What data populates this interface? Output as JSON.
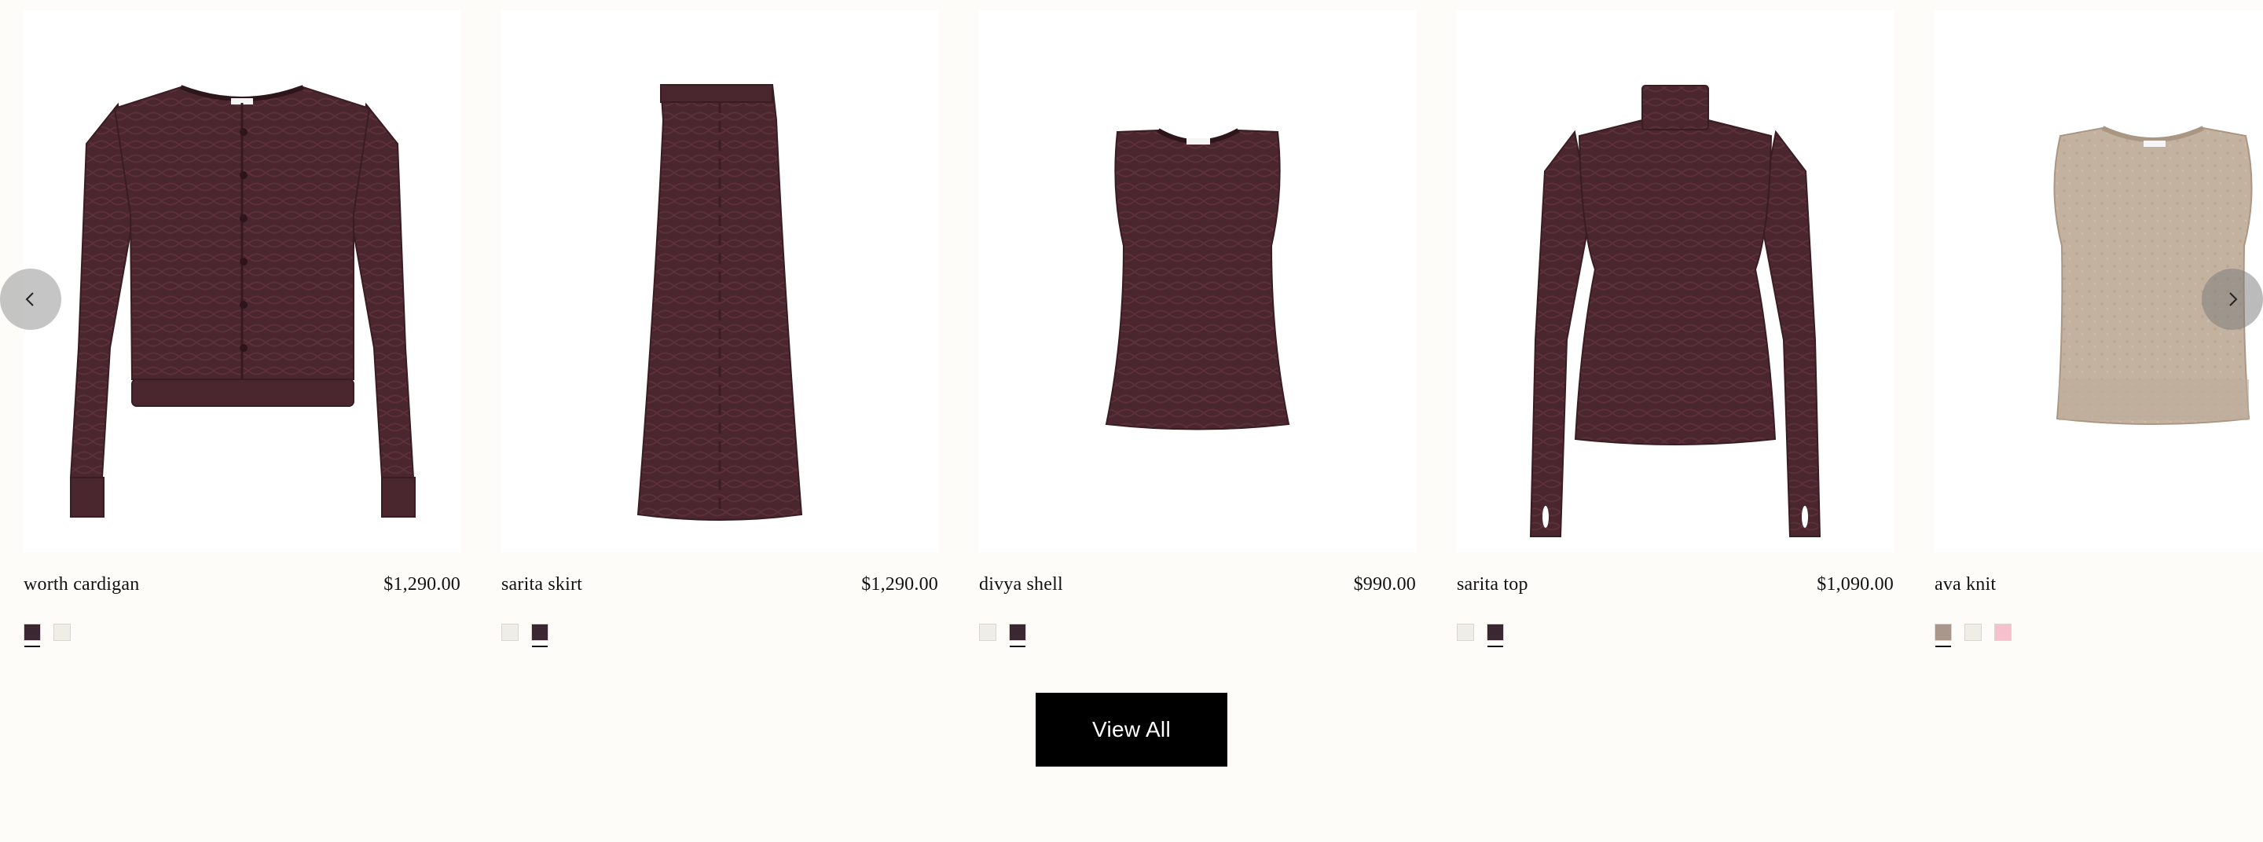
{
  "products": [
    {
      "name": "worth cardigan",
      "price": "$1,290.00",
      "image_icon": "cardigan-image",
      "swatches": [
        {
          "color": "#3b2731",
          "selected": true
        },
        {
          "color": "#efeee6",
          "selected": false
        }
      ]
    },
    {
      "name": "sarita skirt",
      "price": "$1,290.00",
      "image_icon": "skirt-image",
      "swatches": [
        {
          "color": "#efeee6",
          "selected": false
        },
        {
          "color": "#3b2731",
          "selected": true
        }
      ]
    },
    {
      "name": "divya shell",
      "price": "$990.00",
      "image_icon": "shell-top-image",
      "swatches": [
        {
          "color": "#efeee6",
          "selected": false
        },
        {
          "color": "#3b2731",
          "selected": true
        }
      ]
    },
    {
      "name": "sarita top",
      "price": "$1,090.00",
      "image_icon": "turtleneck-image",
      "swatches": [
        {
          "color": "#efeee6",
          "selected": false
        },
        {
          "color": "#3b2731",
          "selected": true
        }
      ]
    },
    {
      "name": "ava knit",
      "price": "",
      "image_icon": "knit-vest-image",
      "swatches": [
        {
          "color": "#a8978a",
          "selected": true
        },
        {
          "color": "#efeee6",
          "selected": false
        },
        {
          "color": "#f6c1cc",
          "selected": false
        }
      ]
    }
  ],
  "carousel": {
    "prev_icon": "chevron-left-icon",
    "next_icon": "chevron-right-icon"
  },
  "view_all_label": "View All",
  "colors": {
    "garment_plum": "#4a262e",
    "garment_taupe": "#c4b2a0",
    "page_bg": "#fdfcf9"
  }
}
